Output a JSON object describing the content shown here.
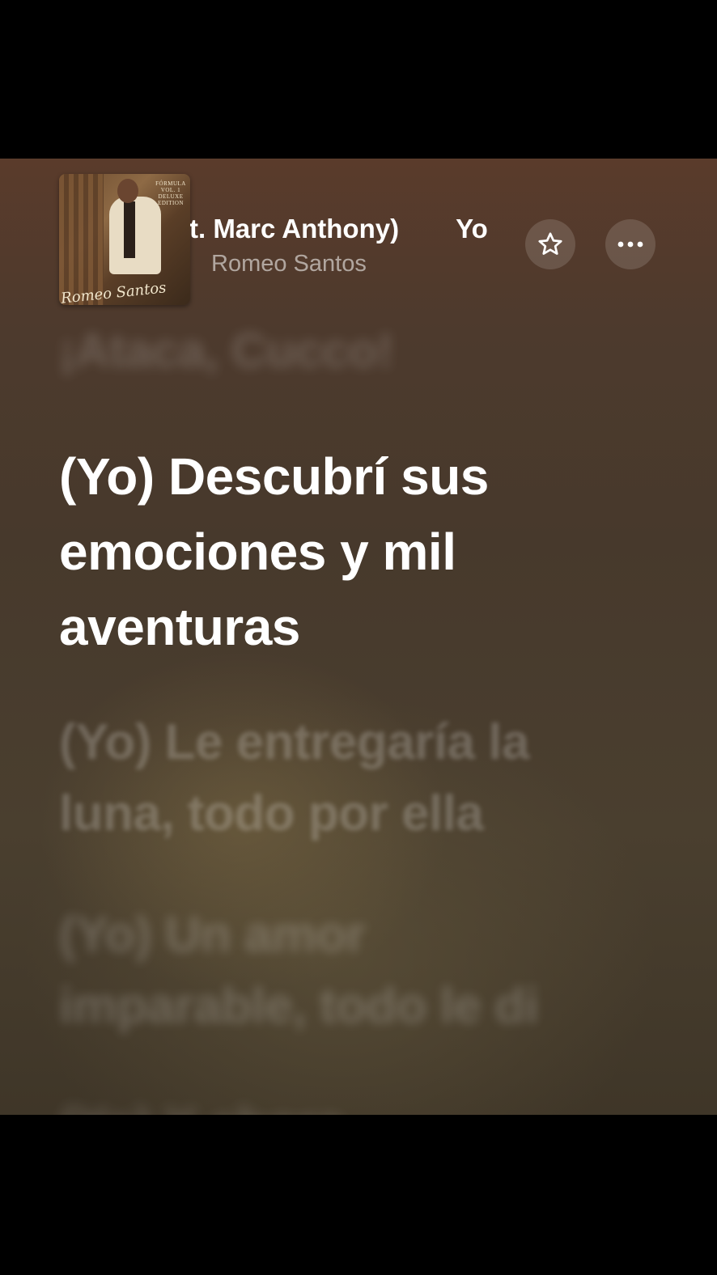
{
  "now_playing": {
    "title_visible": "ft. Marc Anthony)",
    "title_next_fragment": "Yo",
    "artist": "Romeo Santos"
  },
  "album_art": {
    "cover_title": "FÓRMULA VOL. 1 DELUXE EDITION",
    "cover_artist": "Romeo Santos"
  },
  "buttons": {
    "favorite_icon": "star-outline-icon",
    "more_icon": "ellipsis-icon"
  },
  "lyrics": {
    "past": "¡Ataca, Cucco!",
    "current": [
      "(Yo) Descubrí sus",
      "emociones y mil",
      "aventuras"
    ],
    "next1": [
      "(Yo) Le entregaría la",
      "luna, todo por ella"
    ],
    "next2": [
      "(Yo) Un amor",
      "imparable, todo le di"
    ],
    "next3": [
      "(Yo) Y ahora"
    ]
  },
  "colors": {
    "background_top": "#5a3b2b",
    "background_bottom": "#3f3628",
    "active_lyric": "#ffffff",
    "letterbox": "#000000"
  }
}
